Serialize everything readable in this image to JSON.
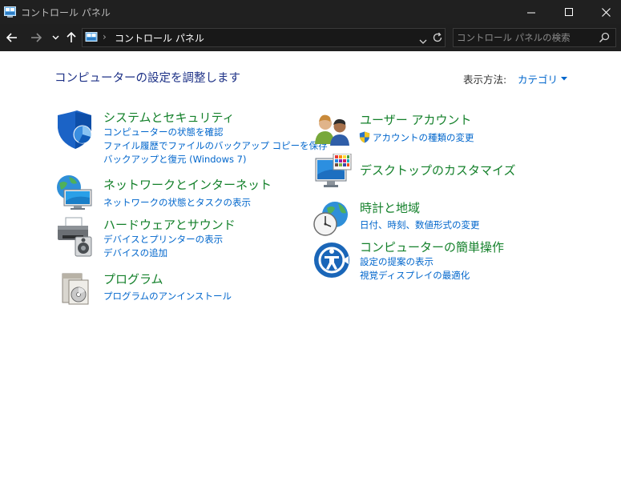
{
  "window": {
    "title": "コントロール パネル",
    "controls": {
      "minimize": "minimize-icon",
      "maximize": "maximize-icon",
      "close": "close-icon"
    }
  },
  "nav": {
    "back_icon": "back-arrow-icon",
    "forward_icon": "forward-arrow-icon",
    "recent_icon": "chevron-down-icon",
    "up_icon": "up-arrow-icon",
    "address_path": "コントロール パネル",
    "address_separator": "›",
    "search_placeholder": "コントロール パネルの検索"
  },
  "main": {
    "heading": "コンピューターの設定を調整します",
    "view_by_label": "表示方法:",
    "view_by_value": "カテゴリ"
  },
  "categories": {
    "system": {
      "title": "システムとセキュリティ",
      "links": [
        "コンピューターの状態を確認",
        "ファイル履歴でファイルのバックアップ コピーを保存",
        "バックアップと復元 (Windows 7)"
      ]
    },
    "network": {
      "title": "ネットワークとインターネット",
      "links": [
        "ネットワークの状態とタスクの表示"
      ]
    },
    "hardware": {
      "title": "ハードウェアとサウンド",
      "links": [
        "デバイスとプリンターの表示",
        "デバイスの追加"
      ]
    },
    "programs": {
      "title": "プログラム",
      "links": [
        "プログラムのアンインストール"
      ]
    },
    "user_accounts": {
      "title": "ユーザー アカウント",
      "links": [
        "アカウントの種類の変更"
      ]
    },
    "appearance": {
      "title": "デスクトップのカスタマイズ",
      "links": []
    },
    "clock": {
      "title": "時計と地域",
      "links": [
        "日付、時刻、数値形式の変更"
      ]
    },
    "ease": {
      "title": "コンピューターの簡単操作",
      "links": [
        "設定の提案の表示",
        "視覚ディスプレイの最適化"
      ]
    }
  },
  "colors": {
    "titlebar": "#202020",
    "category_title": "#13802a",
    "link": "#0066cc",
    "heading": "#1e3287"
  }
}
